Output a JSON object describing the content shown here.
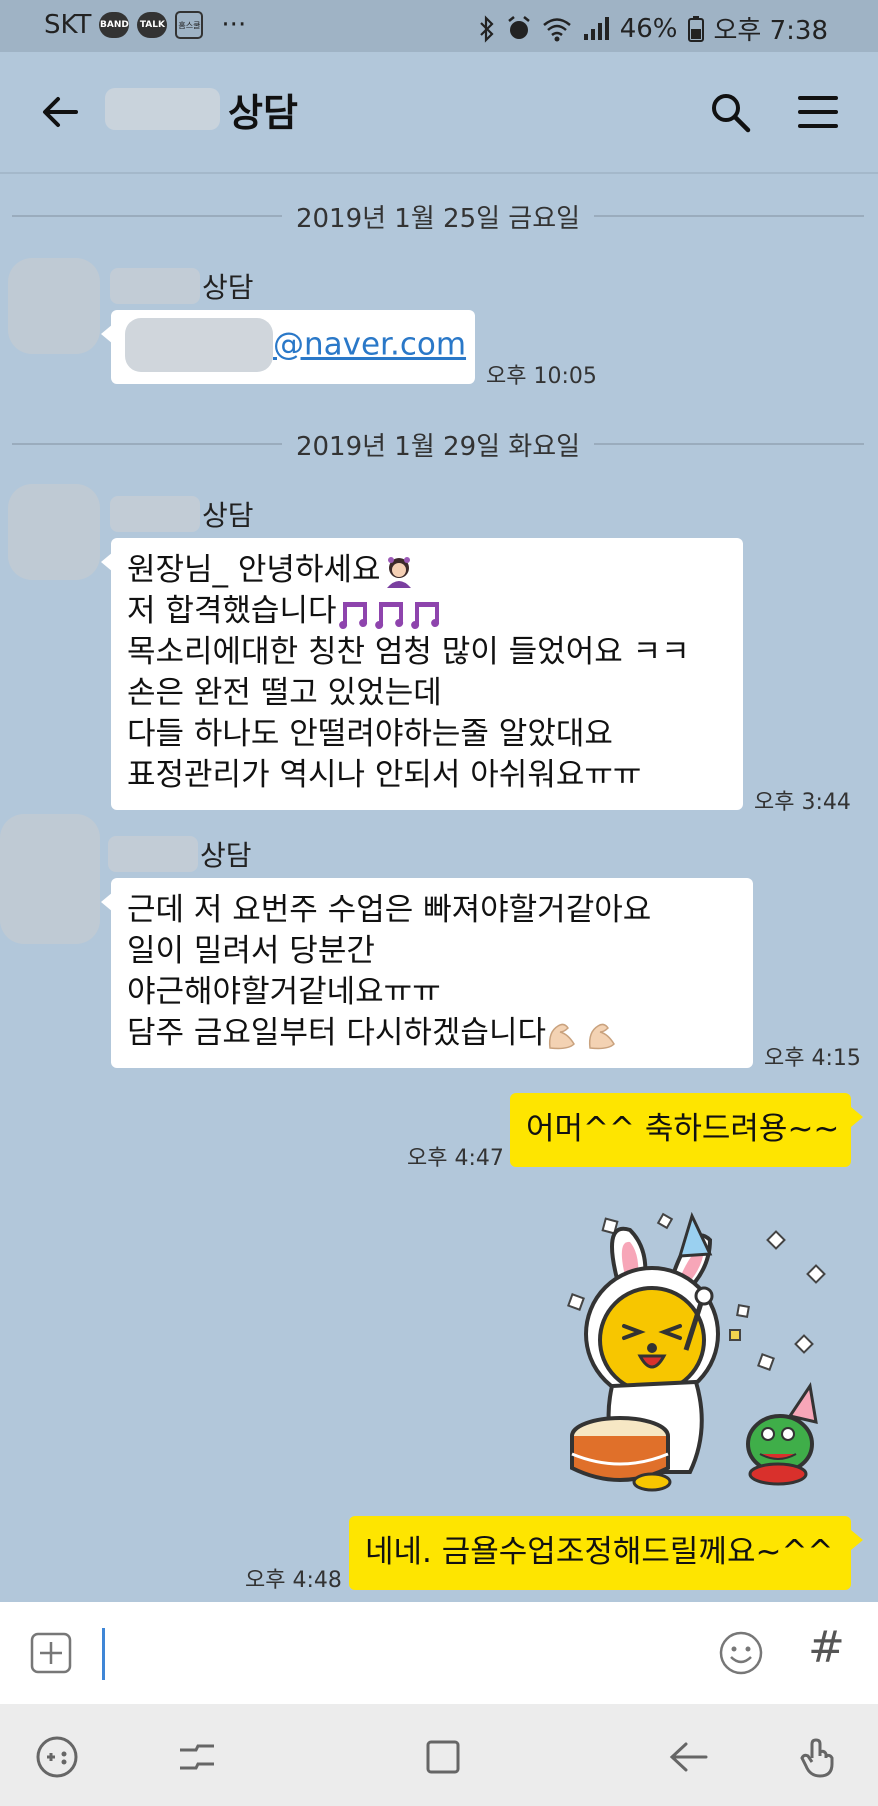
{
  "status_bar": {
    "carrier": "SKT",
    "app_icons": [
      "BAND",
      "TALK",
      "홈스쿨"
    ],
    "more": "···",
    "battery": "46%",
    "clock": "오후 7:38"
  },
  "header": {
    "title": "상담"
  },
  "messages": {
    "date1": "2019년 1월 25일 금요일",
    "m1_sender": "상담",
    "m1_email_domain": "@naver.com",
    "m1_time": "오후 10:05",
    "date2": "2019년 1월 29일 화요일",
    "m2_sender": "상담",
    "m2_lines": [
      "원장님_ 안녕하세요",
      "저 합격했습니다",
      "목소리에대한 칭찬 엄청 많이 들었어요 ㅋㅋ",
      "손은 완전 떨고 있었는데",
      "다들 하나도 안떨려야하는줄 알았대요",
      "표정관리가 역시나 안되서 아쉬워요ㅠㅠ"
    ],
    "m2_time": "오후 3:44",
    "m3_sender": "상담",
    "m3_lines": [
      "근데 저 요번주 수업은 빠져야할거같아요",
      "일이 밀려서 당분간",
      "야근해야할거같네요ㅠㅠ",
      "담주 금요일부터 다시하겠습니다"
    ],
    "m3_time": "오후 4:15",
    "m4_text": "어머^^  축하드려용~~",
    "m4_time": "오후 4:47",
    "m5_text": "네네. 금욜수업조정해드릴께요~^^",
    "m5_time": "오후 4:48"
  },
  "input": {
    "hash": "#"
  },
  "icons": {
    "back": "arrow-left-icon",
    "search": "search-icon",
    "menu": "hamburger-menu-icon",
    "add": "plus-square-icon",
    "emoji": "smile-icon",
    "sticker": "rabbit-drummer-sticker"
  },
  "colors": {
    "chat_bg": "#b2c7da",
    "my_bubble": "#fee500",
    "other_bubble": "#ffffff",
    "link": "#2a78c8"
  }
}
